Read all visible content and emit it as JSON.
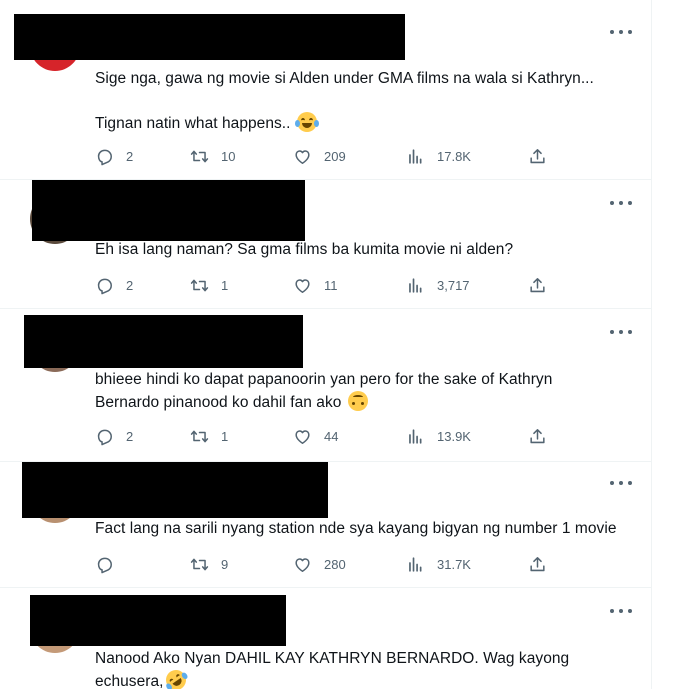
{
  "tweets": [
    {
      "text_lines": [
        "Sige nga, gawa ng movie si Alden under GMA films na wala si Kathryn...",
        "",
        "Tignan natin what happens.."
      ],
      "emoji": "face-with-tears-of-joy",
      "replies": "2",
      "retweets": "10",
      "likes": "209",
      "views": "17.8K",
      "avatar_color": "#d6242a"
    },
    {
      "text_lines": [
        "Eh isa lang naman? Sa gma films ba kumita movie ni alden?"
      ],
      "replies": "2",
      "retweets": "1",
      "likes": "11",
      "views": "3,717",
      "avatar_color": "#5a4a3c"
    },
    {
      "text_lines": [
        "bhieee hindi ko dapat papanoorin yan pero for the sake of Kathryn",
        "Bernardo pinanood ko dahil fan ako"
      ],
      "emoji": "upside-down-face",
      "replies": "2",
      "retweets": "1",
      "likes": "44",
      "views": "13.9K",
      "avatar_color": "#8a6a58"
    },
    {
      "text_lines": [
        "Fact lang na sarili nyang station nde sya kayang bigyan ng number 1 movie"
      ],
      "replies": "",
      "retweets": "9",
      "likes": "280",
      "views": "31.7K",
      "avatar_color": "#b89070"
    },
    {
      "text_lines": [
        "Nanood Ako Nyan DAHIL KAY KATHRYN BERNARDO. Wag kayong",
        "echusera,"
      ],
      "emoji": "rolling-on-the-floor-laughing",
      "avatar_color": "#c49a78"
    }
  ]
}
